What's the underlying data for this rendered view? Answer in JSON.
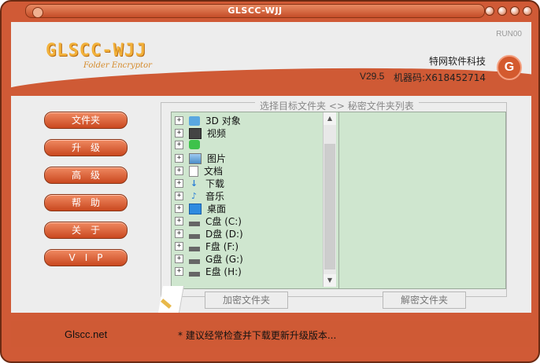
{
  "window": {
    "title": "GLSCC-WJJ"
  },
  "header": {
    "logo_main": "GLSCC-WJJ",
    "logo_sub": "Folder Encryptor",
    "run_tag": "RUN00",
    "company": "特网软件科技",
    "version": "V29.5",
    "machine_code": "机器码:X618452714",
    "badge_letter": "G"
  },
  "sidebar": {
    "items": [
      {
        "label": "文件夹"
      },
      {
        "label": "升　级"
      },
      {
        "label": "高　级"
      },
      {
        "label": "帮　助"
      },
      {
        "label": "关　于"
      },
      {
        "label": "V　I　P"
      }
    ]
  },
  "main": {
    "frame_title": "选择目标文件夹 <> 秘密文件夹列表",
    "tree": [
      {
        "label": "3D 对象",
        "icon": "3d-objects-icon"
      },
      {
        "label": "视频",
        "icon": "video-icon"
      },
      {
        "label": "",
        "icon": "app-icon"
      },
      {
        "label": "图片",
        "icon": "pictures-icon"
      },
      {
        "label": "文档",
        "icon": "documents-icon"
      },
      {
        "label": "下载",
        "icon": "download-icon"
      },
      {
        "label": "音乐",
        "icon": "music-icon"
      },
      {
        "label": "桌面",
        "icon": "desktop-icon"
      },
      {
        "label": "C盘 (C:)",
        "icon": "drive-icon"
      },
      {
        "label": "D盘 (D:)",
        "icon": "drive-icon"
      },
      {
        "label": "F盘 (F:)",
        "icon": "drive-icon"
      },
      {
        "label": "G盘 (G:)",
        "icon": "drive-icon"
      },
      {
        "label": "E盘 (H:)",
        "icon": "drive-icon"
      }
    ],
    "encrypt_button": "加密文件夹",
    "decrypt_button": "解密文件夹"
  },
  "status": {
    "site": "Glscc.net",
    "message": "* 建议经常检查并下载更新升级版本..."
  },
  "colors": {
    "accent": "#cf5a35",
    "pane": "#cfe6cf"
  }
}
